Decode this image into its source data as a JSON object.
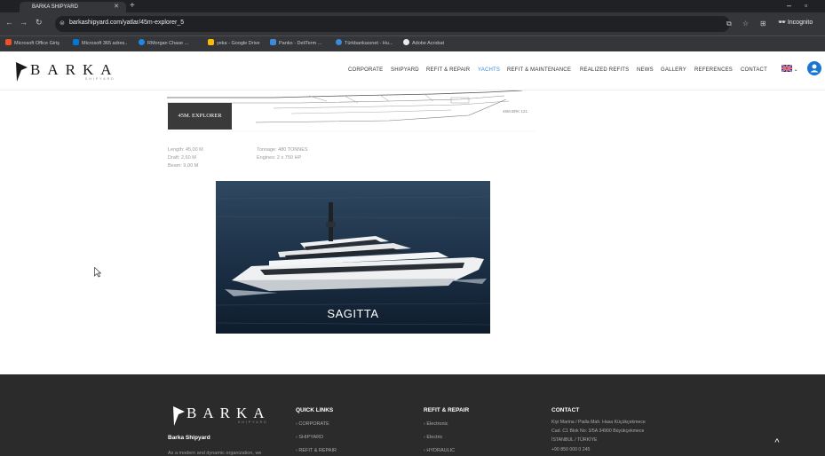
{
  "browser": {
    "tab_title": "BARKA SHIPYARD",
    "url": "barkashipyard.com/yatlar/45m-explorer_5",
    "incognito_label": "Incognito",
    "bookmarks": [
      "Microsoft Office Giriş",
      "Microsoft 365 adres..",
      "RMorgan Chase ...",
      "yeka - Google Drive",
      "Panko - DeliTerm ...",
      "Türkbankasınet - Hu...",
      "Adobe Acrobat"
    ]
  },
  "site": {
    "logo_text": "BARKA",
    "logo_sub": "SHIPYARD",
    "menu": [
      "CORPORATE",
      "SHIPYARD",
      "REFIT & REPAIR",
      "YACHTS",
      "REFIT & MAINTENANCE",
      "REALIZED REFITS",
      "NEWS",
      "GALLERY",
      "REFERENCES",
      "CONTACT"
    ],
    "active_menu": "YACHTS",
    "language": "EN"
  },
  "content": {
    "model_label": "45M. EXPLORER",
    "drawing_caption": "45M BRK 121",
    "specs_left": [
      "Length: 45,00 M",
      "Draft: 2,60 M",
      "Beam: 9,00 M"
    ],
    "specs_right": [
      "Tonnage: 480 TONNES",
      "Engines: 2 x 750 HP"
    ],
    "photo_caption": "SAGITTA"
  },
  "footer": {
    "company_name": "Barka Shipyard",
    "company_desc": "As a modern and dynamic organization, we",
    "quick_links_title": "QUICK LINKS",
    "quick_links": [
      "CORPORATE",
      "SHIPYARD",
      "REFIT & REPAIR"
    ],
    "refit_title": "REFIT & REPAIR",
    "refit_links": [
      "Electronic",
      "Electric",
      "HYDRAULIC"
    ],
    "contact_title": "CONTACT",
    "contact_lines": [
      "Kiyi Marina / Pialla Mah. Hasa Küçükçekmece",
      "Cad. C1 Blok No: 3/5A 34900 Büyükçekmece",
      "İSTANBUL / TÜRKİYE",
      "+90 850 000 0 245"
    ]
  },
  "colors": {
    "accent": "#3b8bd9",
    "footer_bg": "#2b2b2b",
    "chrome_dark": "#202124"
  }
}
